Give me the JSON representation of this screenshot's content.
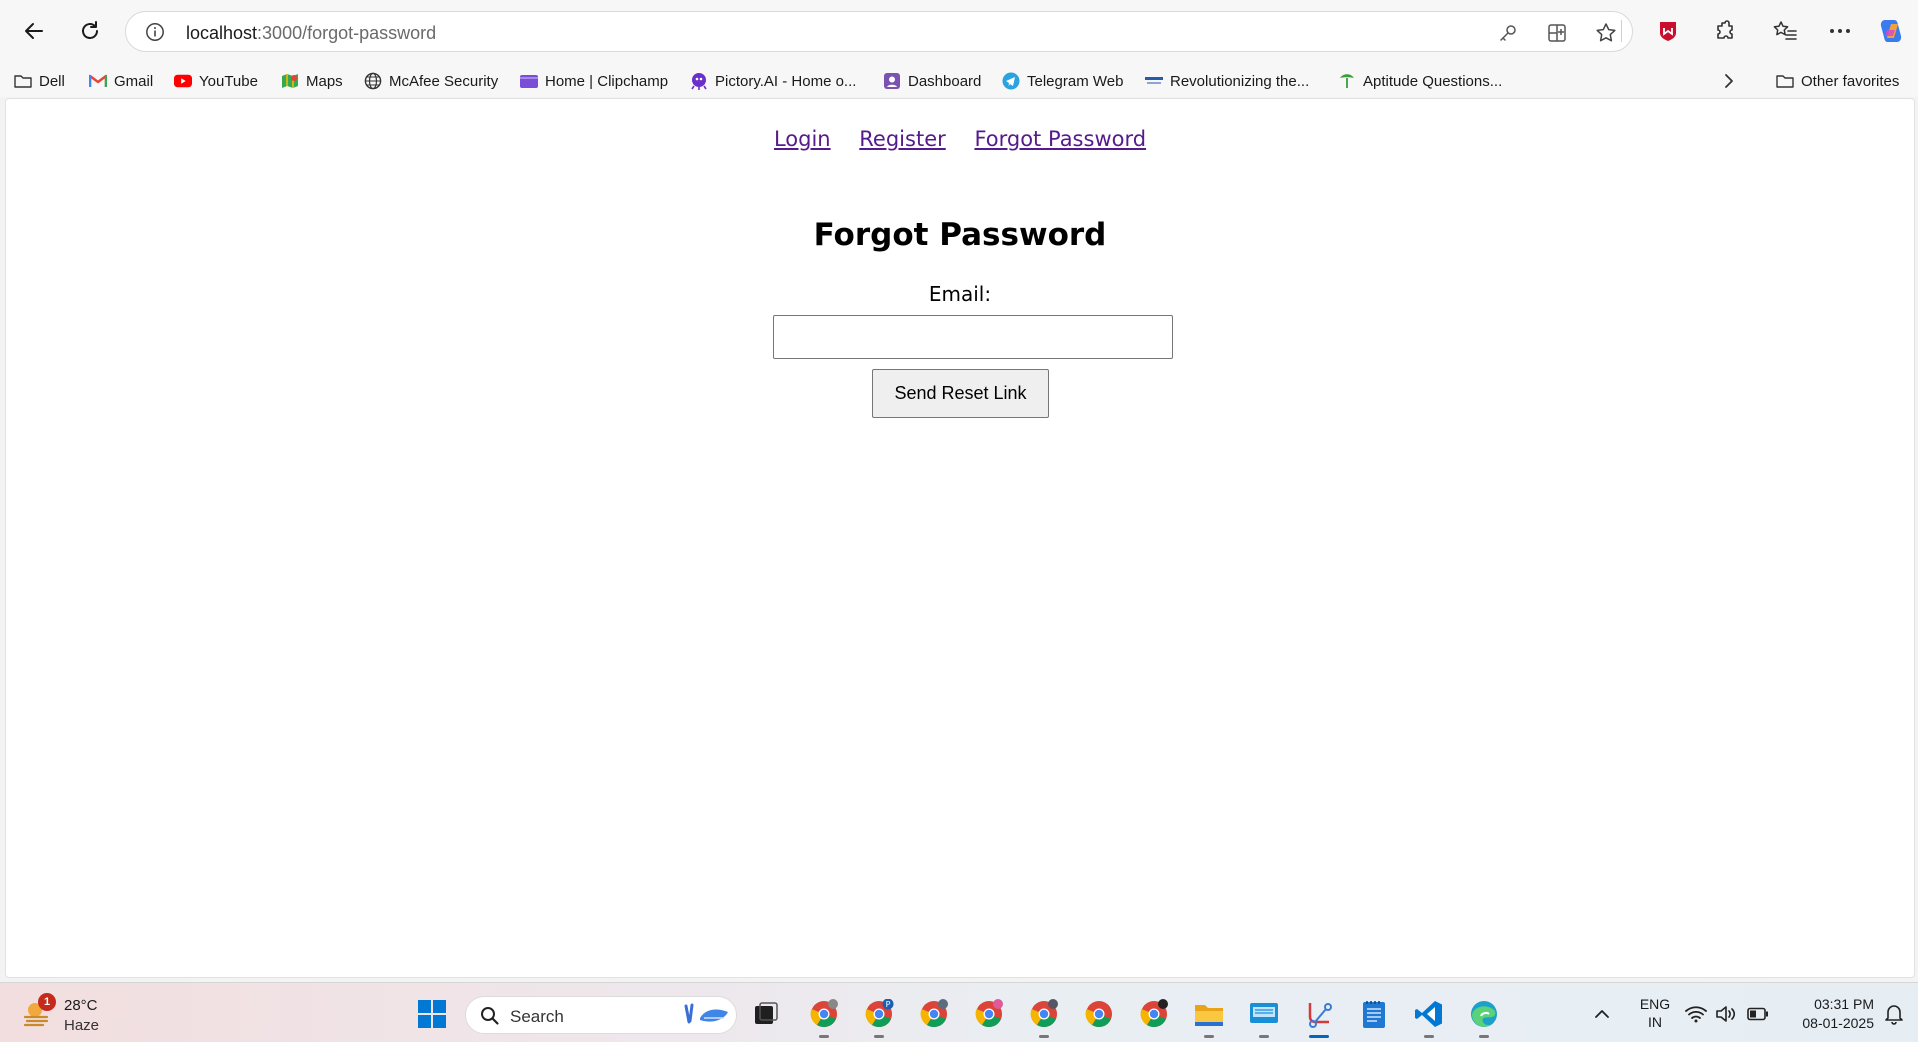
{
  "browser": {
    "url_host": "localhost",
    "url_path": ":3000/forgot-password"
  },
  "bookmarks": [
    {
      "label": "Dell",
      "icon": "folder-icon"
    },
    {
      "label": "Gmail",
      "icon": "gmail-icon"
    },
    {
      "label": "YouTube",
      "icon": "youtube-icon"
    },
    {
      "label": "Maps",
      "icon": "maps-icon"
    },
    {
      "label": "McAfee Security",
      "icon": "globe-icon"
    },
    {
      "label": "Home | Clipchamp",
      "icon": "clipchamp-icon"
    },
    {
      "label": "Pictory.AI - Home o...",
      "icon": "pictory-icon"
    },
    {
      "label": "Dashboard",
      "icon": "dashboard-icon"
    },
    {
      "label": "Telegram Web",
      "icon": "telegram-icon"
    },
    {
      "label": "Revolutionizing the...",
      "icon": "site-icon"
    },
    {
      "label": "Aptitude Questions...",
      "icon": "aptitude-icon"
    }
  ],
  "other_favorites": "Other favorites",
  "page": {
    "nav": {
      "login": "Login",
      "register": "Register",
      "forgot_password": "Forgot Password"
    },
    "title": "Forgot Password",
    "email_label": "Email:",
    "email_value": "",
    "submit_label": "Send Reset Link"
  },
  "taskbar": {
    "weather_temp": "28°C",
    "weather_condition": "Haze",
    "weather_badge": "1",
    "search_label": "Search",
    "language": "ENG",
    "region": "IN",
    "time": "03:31 PM",
    "date": "08-01-2025"
  },
  "colors": {
    "link_visited": "#551a8b",
    "windows_blue": "#0078d4",
    "youtube_red": "#ff0000"
  }
}
